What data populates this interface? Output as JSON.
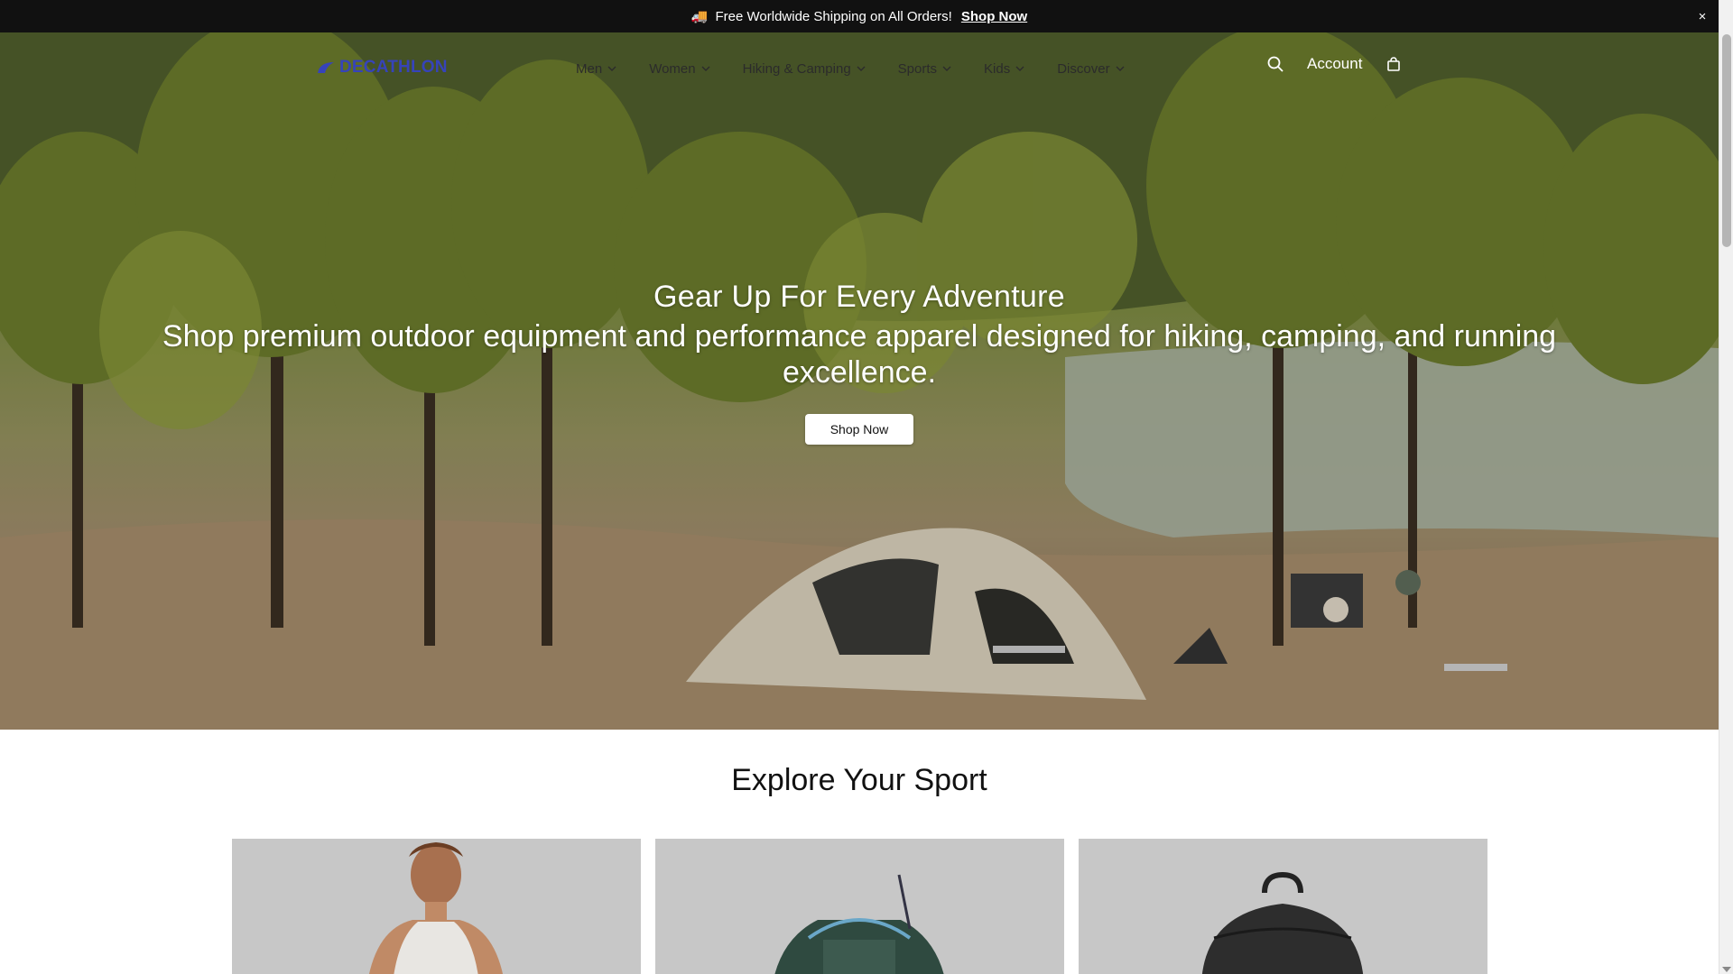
{
  "announcement": {
    "icon": "truck-icon",
    "text": "Free Worldwide Shipping on All Orders!",
    "link_label": "Shop Now",
    "close_label": "×"
  },
  "brand": {
    "name": "DECATHLON",
    "color": "#3643ba"
  },
  "nav": {
    "items": [
      {
        "label": "Men",
        "has_dropdown": true
      },
      {
        "label": "Women",
        "has_dropdown": true
      },
      {
        "label": "Hiking & Camping",
        "has_dropdown": true
      },
      {
        "label": "Sports",
        "has_dropdown": true
      },
      {
        "label": "Kids",
        "has_dropdown": true
      },
      {
        "label": "Discover",
        "has_dropdown": true
      }
    ],
    "account_label": "Account",
    "icons": [
      "search-icon",
      "bag-icon"
    ]
  },
  "hero": {
    "title": "Gear Up For Every Adventure",
    "subtitle": "Shop premium outdoor equipment and performance apparel designed for hiking, camping, and running excellence.",
    "button_label": "Shop Now"
  },
  "explore": {
    "title": "Explore Your Sport",
    "cards": [
      {
        "image": "running-vest-model"
      },
      {
        "image": "hydration-vest"
      },
      {
        "image": "black-backpack"
      }
    ]
  }
}
